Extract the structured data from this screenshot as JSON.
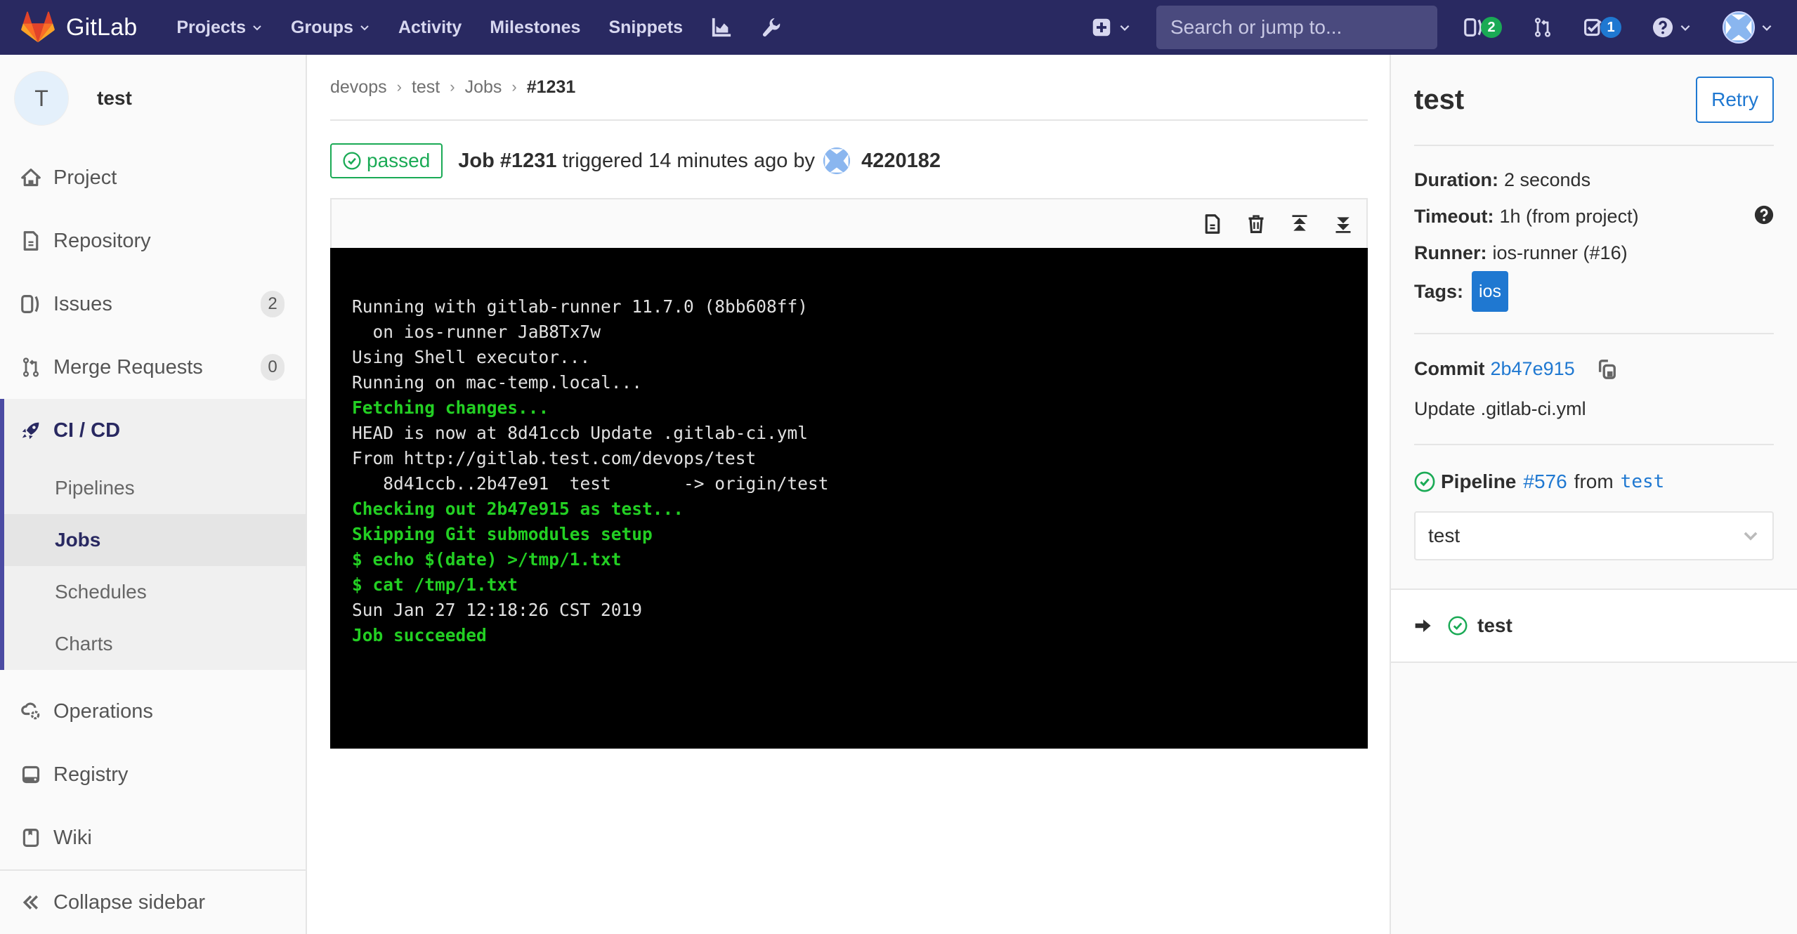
{
  "navbar": {
    "brand": "GitLab",
    "links": [
      {
        "label": "Projects",
        "has_caret": true
      },
      {
        "label": "Groups",
        "has_caret": true
      },
      {
        "label": "Activity",
        "has_caret": false
      },
      {
        "label": "Milestones",
        "has_caret": false
      },
      {
        "label": "Snippets",
        "has_caret": false
      }
    ],
    "icons": [
      "chart-icon",
      "wrench-icon"
    ],
    "search_placeholder": "Search or jump to...",
    "issues_count": "2",
    "todos_count": "1",
    "colors": {
      "background": "#292961",
      "search_bg": "#4a4a7e",
      "issues_badge": "#1aaa55",
      "todos_badge": "#1f78d1"
    }
  },
  "sidebar": {
    "context": {
      "avatar_letter": "T",
      "name": "test"
    },
    "items": [
      {
        "label": "Project",
        "icon": "home-icon"
      },
      {
        "label": "Repository",
        "icon": "doc-icon"
      },
      {
        "label": "Issues",
        "icon": "issues-icon",
        "count": "2"
      },
      {
        "label": "Merge Requests",
        "icon": "merge-request-icon",
        "count": "0"
      }
    ],
    "active_group": {
      "label": "CI / CD",
      "icon": "rocket-icon",
      "sub_items": [
        {
          "label": "Pipelines",
          "active": false
        },
        {
          "label": "Jobs",
          "active": true
        },
        {
          "label": "Schedules",
          "active": false
        },
        {
          "label": "Charts",
          "active": false
        }
      ]
    },
    "items_after": [
      {
        "label": "Operations",
        "icon": "cloud-gear-icon"
      },
      {
        "label": "Registry",
        "icon": "container-icon"
      },
      {
        "label": "Wiki",
        "icon": "book-icon"
      }
    ],
    "collapse_label": "Collapse sidebar"
  },
  "breadcrumb": [
    {
      "label": "devops"
    },
    {
      "label": "test"
    },
    {
      "label": "Jobs"
    },
    {
      "label": "#1231",
      "current": true
    }
  ],
  "job": {
    "status": "passed",
    "status_color": "#1aaa55",
    "title_bold": "Job #1231",
    "title_rest": "triggered 14 minutes ago by",
    "user": "4220182"
  },
  "terminal": {
    "toolbar": [
      "raw-log-icon",
      "erase-icon",
      "scroll-top-icon",
      "scroll-bottom-icon"
    ],
    "lines": [
      {
        "text": "Running with gitlab-runner 11.7.0 (8bb608ff)",
        "ok": false
      },
      {
        "text": "  on ios-runner JaB8Tx7w",
        "ok": false
      },
      {
        "text": "Using Shell executor...",
        "ok": false
      },
      {
        "text": "Running on mac-temp.local...",
        "ok": false
      },
      {
        "text": "Fetching changes...",
        "ok": true
      },
      {
        "text": "HEAD is now at 8d41ccb Update .gitlab-ci.yml",
        "ok": false
      },
      {
        "text": "From http://gitlab.test.com/devops/test",
        "ok": false
      },
      {
        "text": "   8d41ccb..2b47e91  test       -> origin/test",
        "ok": false
      },
      {
        "text": "Checking out 2b47e915 as test...",
        "ok": true
      },
      {
        "text": "Skipping Git submodules setup",
        "ok": true
      },
      {
        "text": "$ echo $(date) >/tmp/1.txt",
        "ok": true
      },
      {
        "text": "$ cat /tmp/1.txt",
        "ok": true
      },
      {
        "text": "Sun Jan 27 12:18:26 CST 2019",
        "ok": false
      },
      {
        "text": "Job succeeded",
        "ok": true
      }
    ],
    "colors": {
      "background": "#000000",
      "default_text": "#e1e1e1",
      "success_text": "#23cf23"
    }
  },
  "right_sidebar": {
    "title": "test",
    "retry_label": "Retry",
    "duration_label": "Duration:",
    "duration_value": "2 seconds",
    "timeout_label": "Timeout:",
    "timeout_value": "1h (from project)",
    "runner_label": "Runner:",
    "runner_value": "ios-runner (#16)",
    "tags_label": "Tags:",
    "tags": [
      "ios"
    ],
    "commit_label": "Commit",
    "commit_sha": "2b47e915",
    "commit_message": "Update .gitlab-ci.yml",
    "pipeline_label": "Pipeline",
    "pipeline_id": "#576",
    "pipeline_from": "from",
    "pipeline_ref": "test",
    "stage_selected": "test",
    "jobs": [
      {
        "name": "test",
        "status": "passed",
        "current": true
      }
    ]
  }
}
